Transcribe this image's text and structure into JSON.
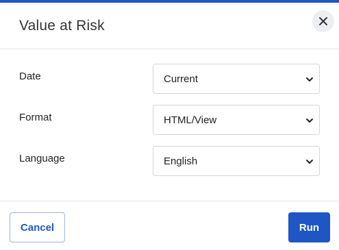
{
  "dialog": {
    "title": "Value at Risk",
    "close_icon": "close-icon"
  },
  "form": {
    "date": {
      "label": "Date",
      "value": "Current"
    },
    "format": {
      "label": "Format",
      "value": "HTML/View"
    },
    "language": {
      "label": "Language",
      "value": "English"
    },
    "chevron_icon": "chevron-down-icon"
  },
  "footer": {
    "cancel_label": "Cancel",
    "run_label": "Run"
  },
  "colors": {
    "accent": "#1f56c4",
    "close_button_bg": "#eceef1",
    "border": "#d3d7dc"
  }
}
